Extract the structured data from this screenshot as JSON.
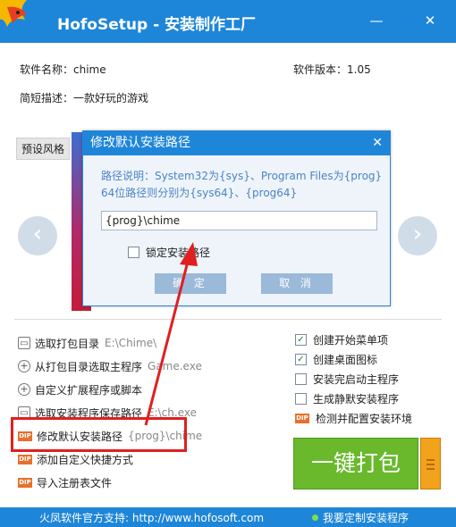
{
  "window": {
    "title": "HofoSetup - 安装制作工厂",
    "minimize_icon": "minimize-icon",
    "close_icon": "close-icon"
  },
  "info": {
    "name_label": "软件名称：chime",
    "version_label": "软件版本：1.05",
    "desc_label": "简短描述：一款好玩的游戏"
  },
  "tabs": {
    "preset_style": "预设风格"
  },
  "operations": [
    {
      "label": "选取打包目录",
      "value": "E:\\Chime\\",
      "icon": "folder-icon"
    },
    {
      "label": "从打包目录选取主程序",
      "value": "Game.exe",
      "icon": "plus-icon"
    },
    {
      "label": "自定义扩展程序或脚本",
      "value": "",
      "icon": "plus-icon"
    },
    {
      "label": "选取安装程序保存路径",
      "value": "E:\\ch.exe",
      "icon": "folder-icon"
    },
    {
      "label": "修改默认安装路径",
      "value": "{prog}\\chime",
      "icon": "dip-icon"
    },
    {
      "label": "添加自定义快捷方式",
      "value": "",
      "icon": "dip-icon"
    },
    {
      "label": "导入注册表文件",
      "value": "",
      "icon": "dip-icon"
    }
  ],
  "options": [
    {
      "label": "创建开始菜单项",
      "checked": true
    },
    {
      "label": "创建桌面图标",
      "checked": true
    },
    {
      "label": "安装完启动主程序",
      "checked": false
    },
    {
      "label": "生成静默安装程序",
      "checked": false
    },
    {
      "label": "检测并配置安装环境",
      "icon": "dip-icon"
    }
  ],
  "build_button": "一键打包",
  "footer": {
    "support": "火凤软件官方支持: http://www.hofosoft.com",
    "custom": "我要定制安装程序"
  },
  "dialog": {
    "title": "修改默认安装路径",
    "note_line1": "路径说明：System32为{sys}、Program Files为{prog}",
    "note_line2": "64位路径则分别为{sys64}、{prog64}",
    "input_value": "{prog}\\chime",
    "lock_label": "锁定安装路径",
    "ok_label": "确 定",
    "cancel_label": "取 消"
  },
  "colors": {
    "accent": "#1e86d8",
    "highlight": "#e01f1f",
    "build_button": "#6ab92d"
  }
}
